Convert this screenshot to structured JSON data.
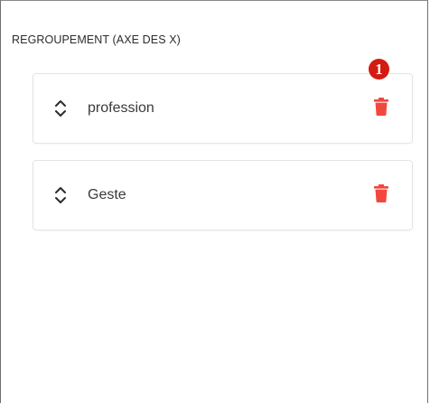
{
  "panel": {
    "title": "REGROUPEMENT (AXE DES X)"
  },
  "groups": [
    {
      "label": "profession",
      "handle_icon": "unfold-icon",
      "delete_icon": "trash-icon"
    },
    {
      "label": "Geste",
      "handle_icon": "unfold-icon",
      "delete_icon": "trash-icon"
    }
  ],
  "annotation": {
    "badge_text": "1"
  },
  "colors": {
    "delete": "#f2473f",
    "badge": "#d41b12",
    "border": "#e4e4e4",
    "text": "#3a3a3a"
  }
}
